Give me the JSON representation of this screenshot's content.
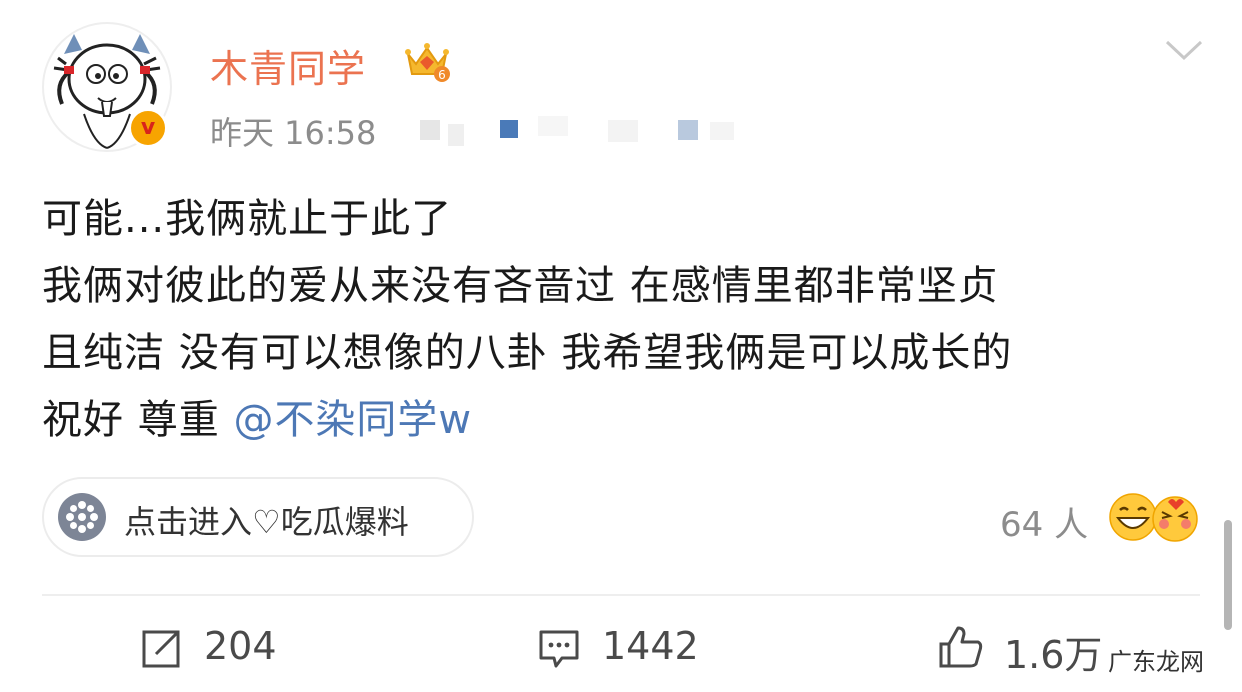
{
  "post": {
    "author": "木青同学",
    "timestamp": "昨天 16:58",
    "badge_letter": "v",
    "crown_level": "6",
    "lines": [
      "可能...我俩就止于此了",
      "我俩对彼此的爱从来没有吝啬过  在感情里都非常坚贞",
      "且纯洁 没有可以想像的八卦 我希望我俩是可以成长的"
    ],
    "last_line_prefix": "祝好 尊重 ",
    "mention": "@不染同学w"
  },
  "topic": {
    "label": "点击进入♡吃瓜爆料"
  },
  "reactions": {
    "count": "64 人"
  },
  "actions": {
    "repost_count": "204",
    "comment_count": "1442",
    "like_count": "1.6万"
  },
  "watermark": "广东龙网",
  "colors": {
    "username": "#eb7350",
    "mention": "#4d78b5",
    "muted": "#8c8c8c",
    "badge": "#f7a400"
  }
}
